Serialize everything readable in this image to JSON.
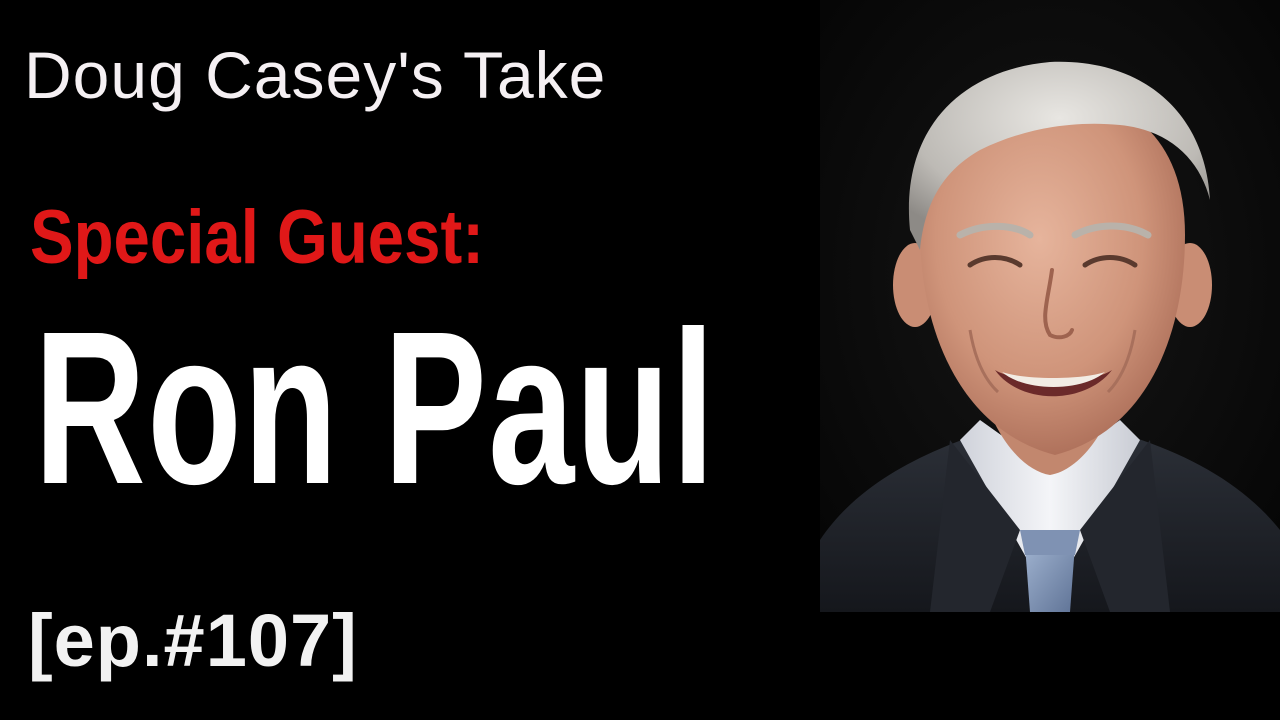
{
  "thumbnail": {
    "show_title": "Doug Casey's Take",
    "label": "Special Guest:",
    "guest_name": "Ron Paul",
    "episode": "[ep.#107]"
  },
  "colors": {
    "background": "#000000",
    "label": "#e01818",
    "text": "#ffffff"
  }
}
